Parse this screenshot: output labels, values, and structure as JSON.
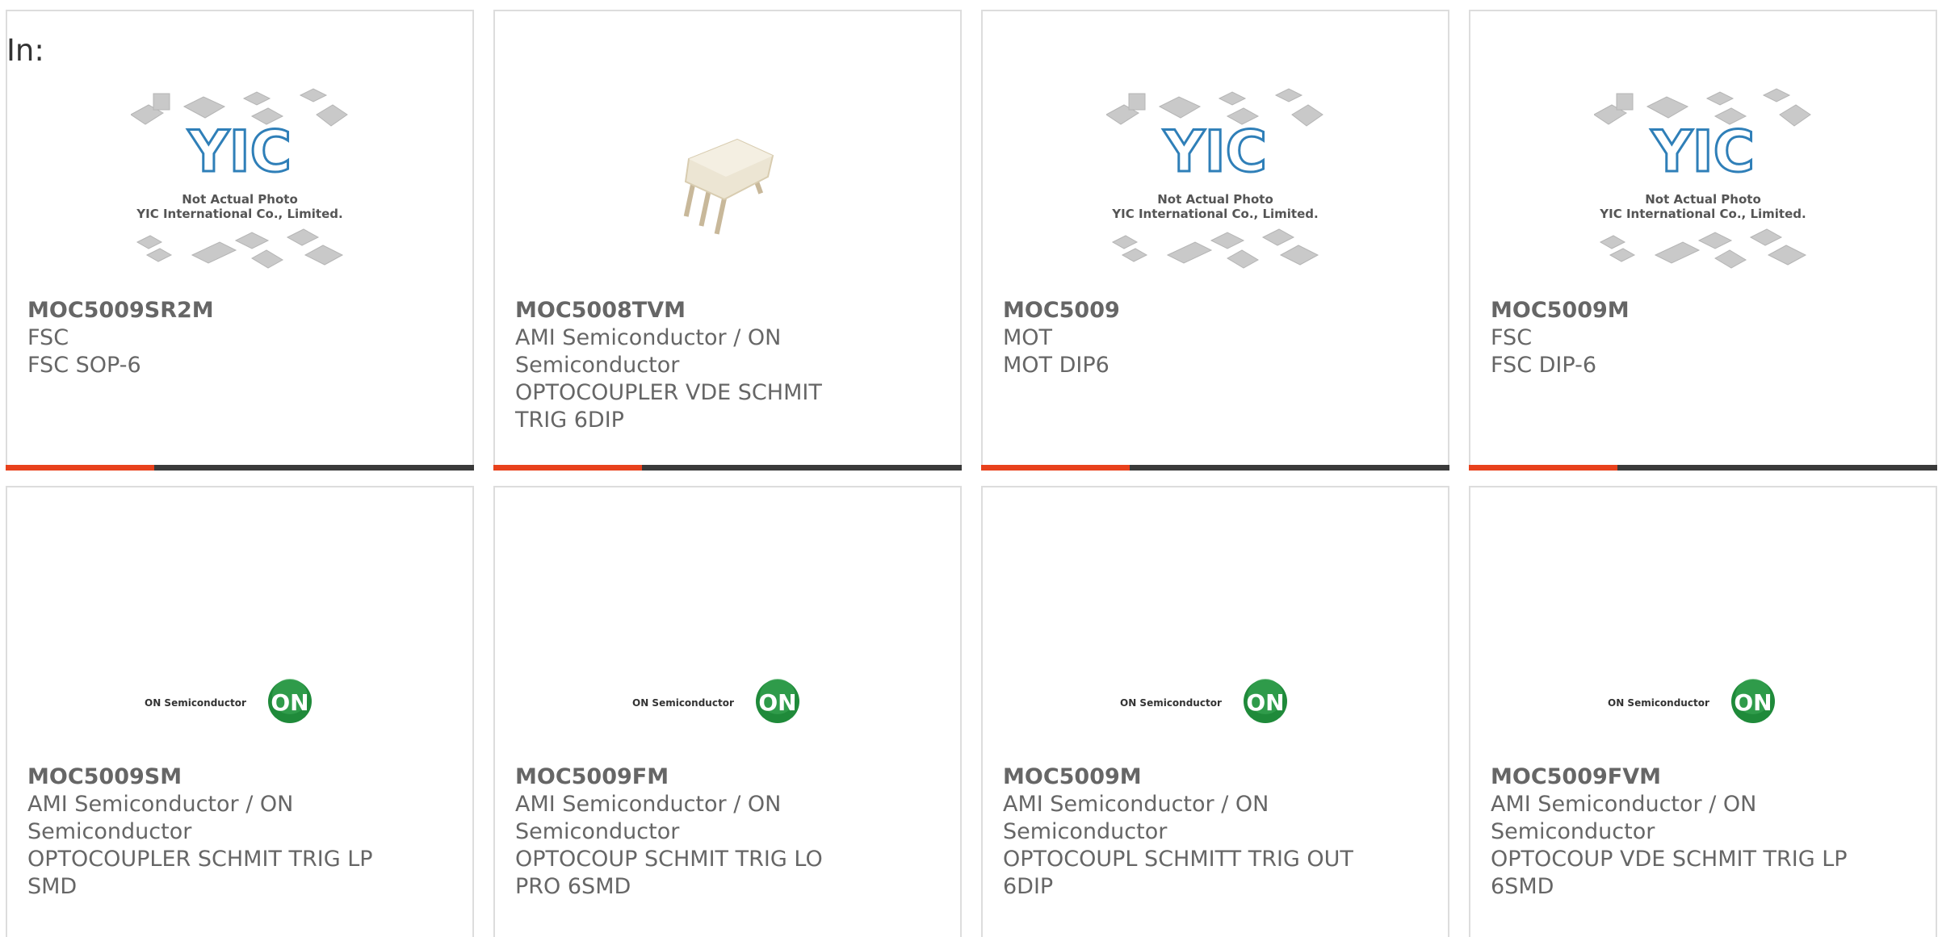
{
  "filter": {
    "label": "In:"
  },
  "brand": {
    "accent": "#e8411c",
    "bar": "#3a3a3a",
    "on_green": "#1f8a3a"
  },
  "logos": {
    "yic_line1": "Not Actual Photo",
    "yic_line2": "YIC International Co., Limited.",
    "yic_mark": "YIC",
    "on_text": "ON Semiconductor",
    "on_mark": "ON"
  },
  "products": [
    {
      "part": "MOC5009SR2M",
      "maker": "FSC",
      "maker2": "",
      "desc": "FSC SOP-6",
      "desc2": "",
      "image": "yic-placeholder"
    },
    {
      "part": "MOC5008TVM",
      "maker": "AMI Semiconductor / ON",
      "maker2": "Semiconductor",
      "desc": "OPTOCOUPLER VDE SCHMIT",
      "desc2": "TRIG 6DIP",
      "image": "dip6-photo"
    },
    {
      "part": "MOC5009",
      "maker": "MOT",
      "maker2": "",
      "desc": "MOT DIP6",
      "desc2": "",
      "image": "yic-placeholder"
    },
    {
      "part": "MOC5009M",
      "maker": "FSC",
      "maker2": "",
      "desc": "FSC DIP-6",
      "desc2": "",
      "image": "yic-placeholder"
    },
    {
      "part": "MOC5009SM",
      "maker": "AMI Semiconductor / ON",
      "maker2": "Semiconductor",
      "desc": "OPTOCOUPLER SCHMIT TRIG LP",
      "desc2": "SMD",
      "image": "on-logo"
    },
    {
      "part": "MOC5009FM",
      "maker": "AMI Semiconductor / ON",
      "maker2": "Semiconductor",
      "desc": "OPTOCOUP SCHMIT TRIG LO",
      "desc2": "PRO 6SMD",
      "image": "on-logo"
    },
    {
      "part": "MOC5009M",
      "maker": "AMI Semiconductor / ON",
      "maker2": "Semiconductor",
      "desc": "OPTOCOUPL SCHMITT TRIG OUT",
      "desc2": "6DIP",
      "image": "on-logo"
    },
    {
      "part": "MOC5009FVM",
      "maker": "AMI Semiconductor / ON",
      "maker2": "Semiconductor",
      "desc": "OPTOCOUP VDE SCHMIT TRIG LP",
      "desc2": "6SMD",
      "image": "on-logo"
    }
  ]
}
